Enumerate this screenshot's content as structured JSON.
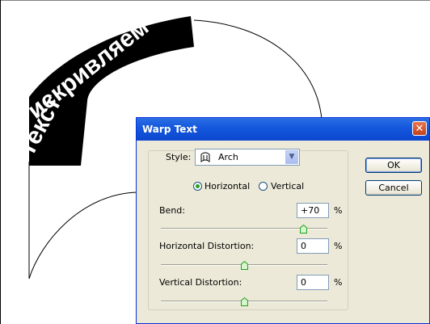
{
  "canvas": {
    "warped_text_line1": "искривляем",
    "warped_text_line2": "текст"
  },
  "dialog": {
    "title": "Warp Text",
    "close_glyph": "✕",
    "style_label": "Style:",
    "style_value": "Arch",
    "style_icon": "arch-icon",
    "orientation": {
      "horizontal_label": "Horizontal",
      "vertical_label": "Vertical",
      "selected": "Horizontal"
    },
    "bend": {
      "label": "Bend:",
      "value": "+70",
      "unit": "%",
      "level": 70
    },
    "horizontal_distortion": {
      "label": "Horizontal Distortion:",
      "value": "0",
      "unit": "%",
      "level": 0
    },
    "vertical_distortion": {
      "label": "Vertical Distortion:",
      "value": "0",
      "unit": "%",
      "level": 0
    },
    "ok_label": "OK",
    "cancel_label": "Cancel"
  },
  "colors": {
    "titlebar": "#0b47cf",
    "dialog_bg": "#ece9d8",
    "radio_selected": "#21a121"
  }
}
